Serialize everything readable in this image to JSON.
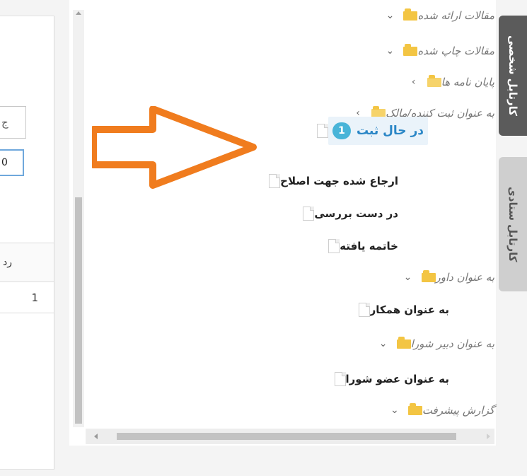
{
  "left_panel": {
    "field1_text": "ج",
    "field2_text": "0",
    "table_header": "رد",
    "table_cell": "1"
  },
  "tree": {
    "nodes": [
      {
        "label": "مقالات ارائه شده",
        "type": "folder",
        "toggle": "⌄",
        "style": "italic"
      },
      {
        "label": "مقالات چاپ شده",
        "type": "folder",
        "toggle": "⌄",
        "style": "italic"
      },
      {
        "label": "پایان نامه ها",
        "type": "folder",
        "toggle": "›",
        "style": "italic"
      },
      {
        "label": "به عنوان ثبت کننده/مالک",
        "type": "folder-open",
        "toggle": "›",
        "style": "italic"
      },
      {
        "label": "در حال ثبت",
        "type": "file",
        "badge": "1",
        "style": "active"
      },
      {
        "label": "ارجاع شده جهت اصلاح",
        "type": "file",
        "style": "bold"
      },
      {
        "label": "در دست بررسی",
        "type": "file",
        "style": "bold"
      },
      {
        "label": "خاتمه یافته",
        "type": "file",
        "style": "bold"
      },
      {
        "label": "به عنوان داور",
        "type": "folder",
        "toggle": "⌄",
        "style": "italic"
      },
      {
        "label": "به عنوان همکار",
        "type": "file",
        "style": "bold"
      },
      {
        "label": "به عنوان دبیر شورا",
        "type": "folder",
        "toggle": "⌄",
        "style": "italic"
      },
      {
        "label": "به عنوان عضو شورا",
        "type": "file",
        "style": "bold"
      },
      {
        "label": "گزارش پیشرفت",
        "type": "folder",
        "toggle": "⌄",
        "style": "italic"
      }
    ]
  },
  "tabs": {
    "personal": "کارتابل شخصی",
    "staff": "کارتابل ستادی"
  },
  "colors": {
    "accent_blue": "#2a86c6",
    "badge_blue": "#48b4d8",
    "folder_yellow": "#f3c543",
    "arrow_orange": "#f07c1e",
    "active_tab": "#5b5b5b"
  }
}
